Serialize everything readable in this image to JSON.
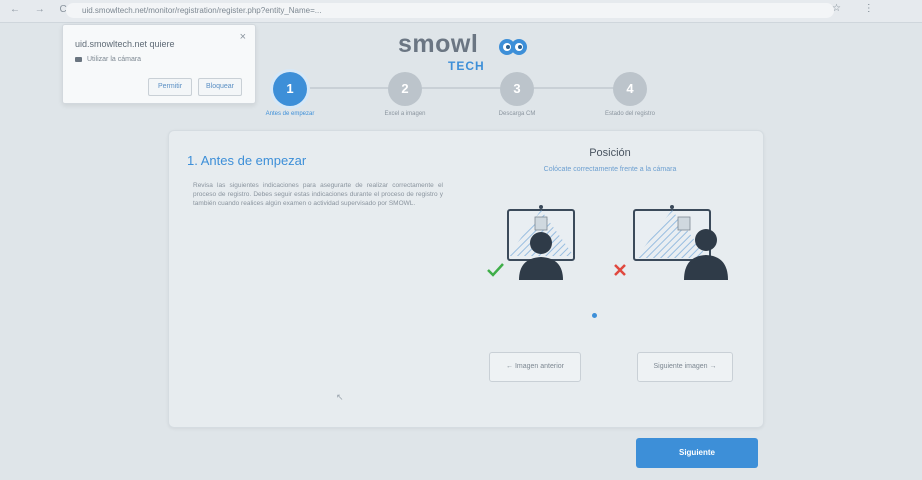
{
  "browser": {
    "url": "uid.smowltech.net/monitor/registration/register.php?entity_Name=...",
    "nav_icons": "← → C"
  },
  "popup": {
    "title": "uid.smowltech.net quiere",
    "permission": "Utilizar la cámara",
    "allow_label": "Permitir",
    "block_label": "Bloquear",
    "close_glyph": "×"
  },
  "logo": {
    "brand": "smowl",
    "sub": "TECH"
  },
  "steps": [
    {
      "number": "1",
      "label": "Antes de empezar",
      "active": true
    },
    {
      "number": "2",
      "label": "Excel a imagen",
      "active": false
    },
    {
      "number": "3",
      "label": "Descarga CM",
      "active": false
    },
    {
      "number": "4",
      "label": "Estado del registro",
      "active": false
    }
  ],
  "main": {
    "title": "1. Antes de empezar",
    "paragraph": "Revisa las siguientes indicaciones para asegurarte de realizar correctamente el proceso de registro. Debes seguir estas indicaciones durante el proceso de registro y también cuando realices algún examen o actividad supervisado por SMOWL."
  },
  "position_panel": {
    "title": "Posición",
    "subtitle": "Colócate correctamente frente a la cámara",
    "correct_icon": "check-icon",
    "wrong_icon": "cross-icon"
  },
  "nav": {
    "prev_label": "← Imagen anterior",
    "next_image_label": "Siguiente imagen →",
    "submit_label": "Siguiente"
  },
  "colors": {
    "accent": "#3d8fd8",
    "correct": "#3fae49",
    "wrong": "#e0483e"
  }
}
